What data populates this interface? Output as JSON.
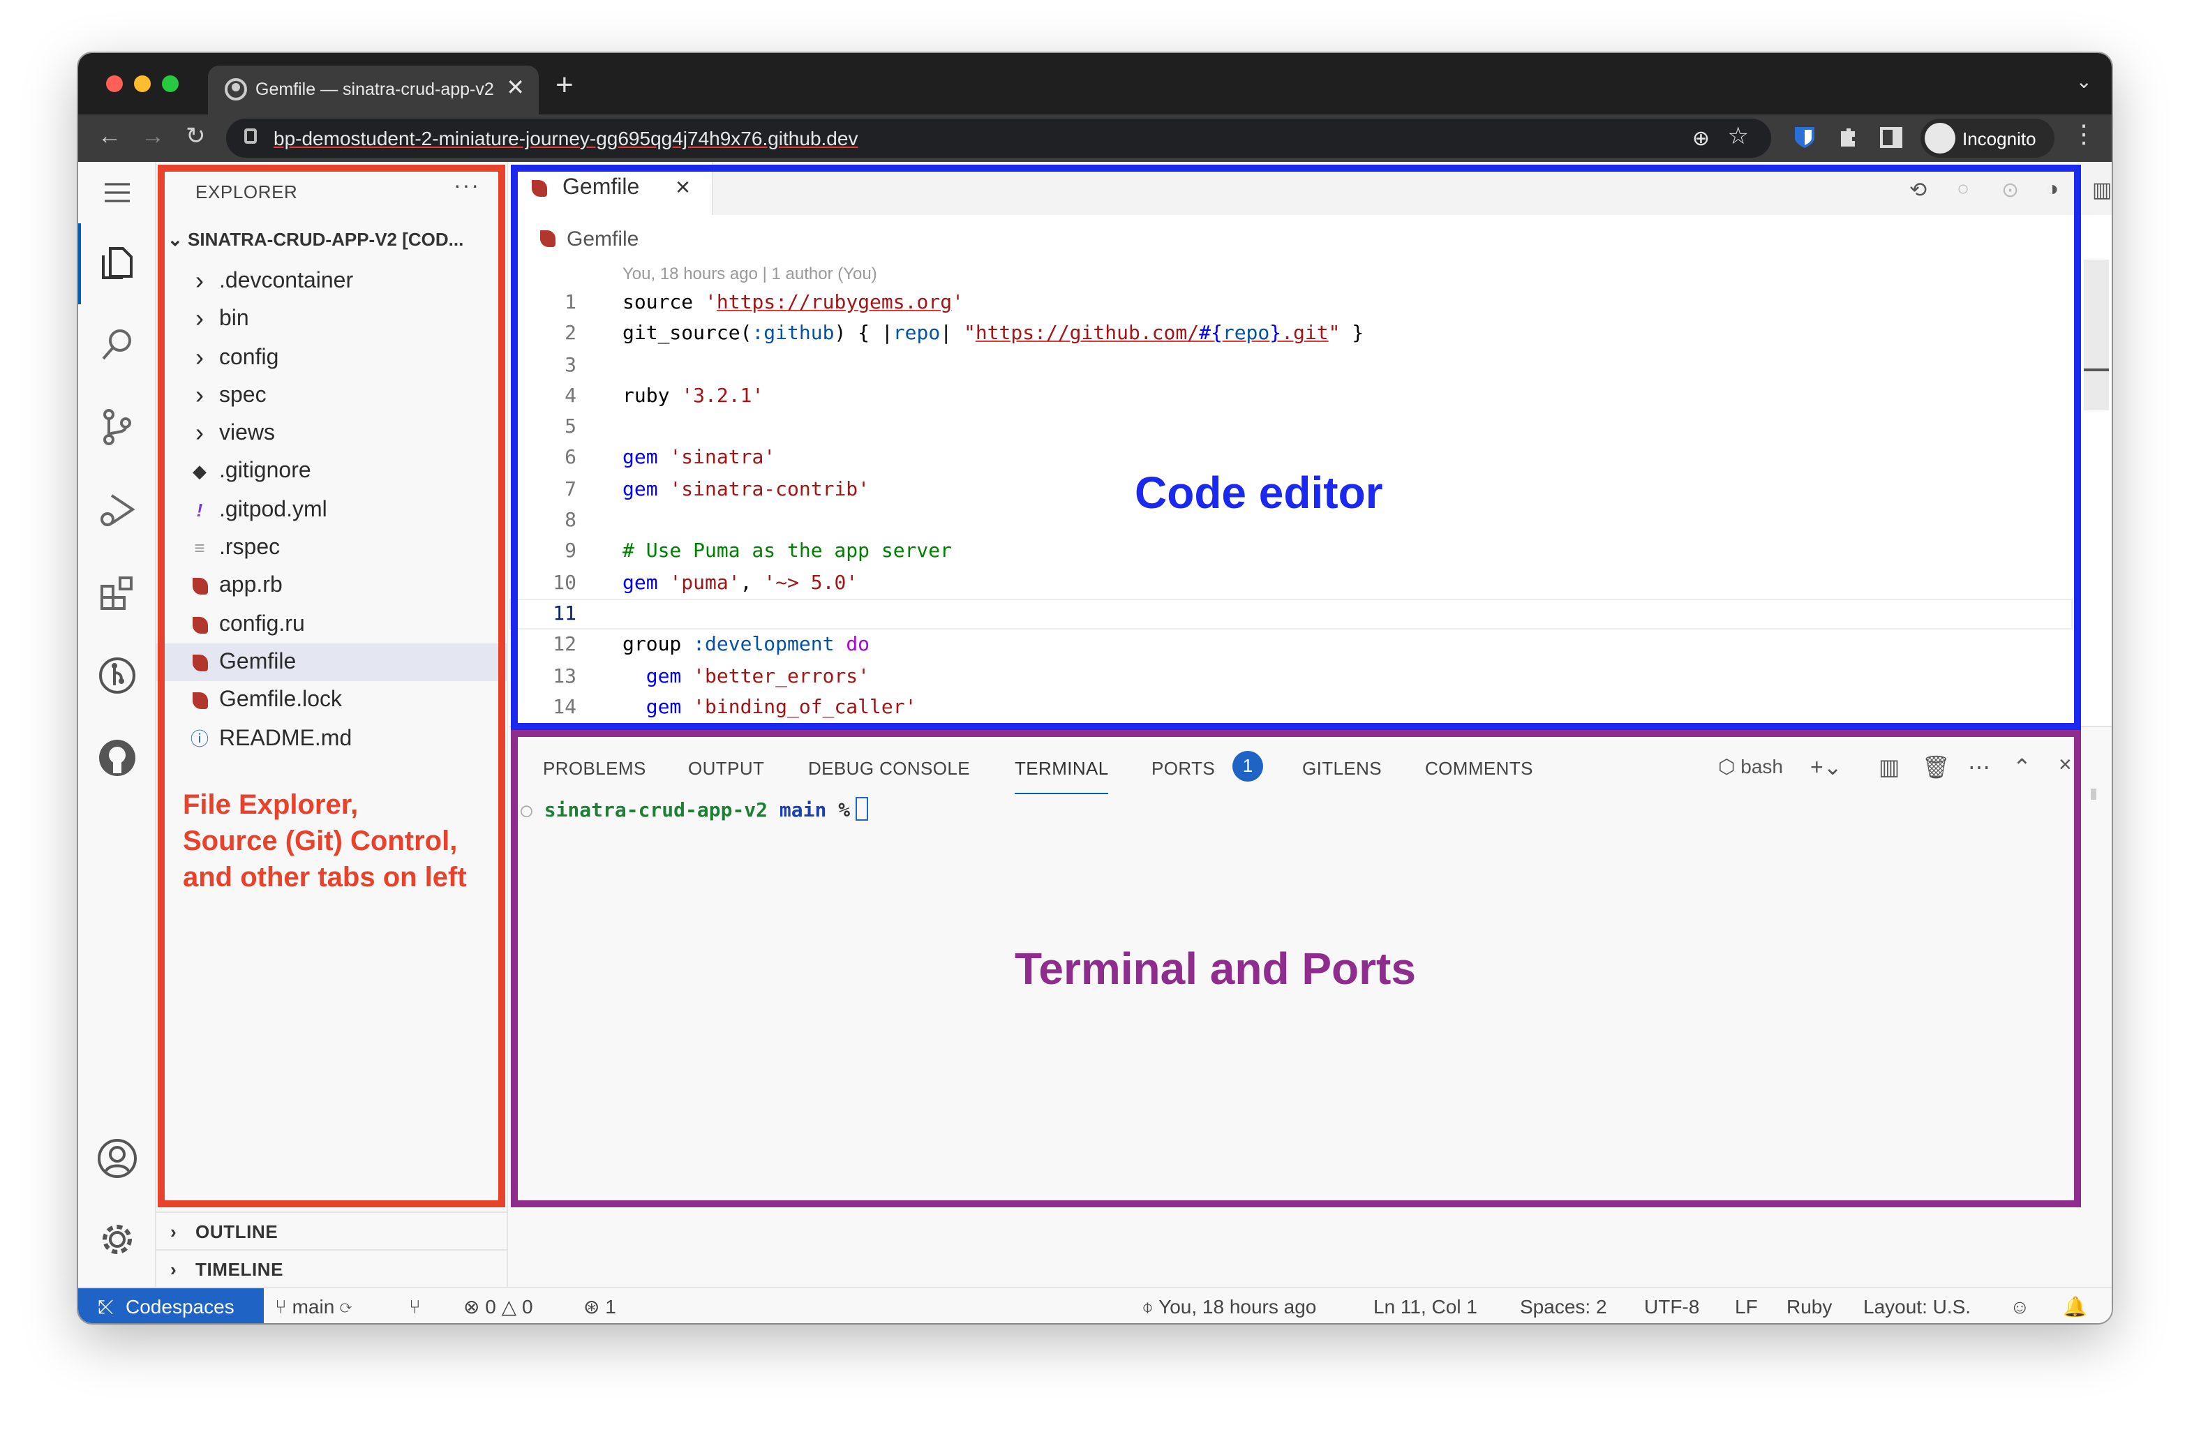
{
  "browser": {
    "tab_title": "Gemfile — sinatra-crud-app-v2",
    "close_glyph": "✕",
    "new_tab_glyph": "+",
    "url": "bp-demostudent-2-miniature-journey-gg695qg4j74h9x76.github.dev",
    "profile": "Incognito"
  },
  "sidebar": {
    "title": "EXPLORER",
    "more": "···",
    "root": "SINATRA-CRUD-APP-V2 [COD...",
    "items": [
      {
        "label": ".devcontainer",
        "icon": "chevron-right-icon",
        "glyph": "›"
      },
      {
        "label": "bin",
        "icon": "chevron-right-icon",
        "glyph": "›"
      },
      {
        "label": "config",
        "icon": "chevron-right-icon",
        "glyph": "›"
      },
      {
        "label": "spec",
        "icon": "chevron-right-icon",
        "glyph": "›"
      },
      {
        "label": "views",
        "icon": "chevron-right-icon",
        "glyph": "›"
      },
      {
        "label": ".gitignore",
        "icon": "git-icon",
        "glyph": "◆"
      },
      {
        "label": ".gitpod.yml",
        "icon": "yaml-icon",
        "glyph": "!"
      },
      {
        "label": ".rspec",
        "icon": "text-file-icon",
        "glyph": "≡"
      },
      {
        "label": "app.rb",
        "icon": "ruby-icon",
        "glyph": ""
      },
      {
        "label": "config.ru",
        "icon": "ruby-icon",
        "glyph": ""
      },
      {
        "label": "Gemfile",
        "icon": "ruby-icon",
        "glyph": "",
        "selected": true
      },
      {
        "label": "Gemfile.lock",
        "icon": "ruby-icon",
        "glyph": ""
      },
      {
        "label": "README.md",
        "icon": "info-icon",
        "glyph": "ⓘ"
      }
    ],
    "outline": "OUTLINE",
    "timeline": "TIMELINE"
  },
  "editor": {
    "tab": "Gemfile",
    "breadcrumb": "Gemfile",
    "blame": "You, 18 hours ago | 1 author (You)",
    "current_line": 11,
    "lines": [
      {
        "no": "1",
        "parts": [
          {
            "t": "source ",
            "c": ""
          },
          {
            "t": "'",
            "c": "str"
          },
          {
            "t": "https://rubygems.org",
            "c": "str url"
          },
          {
            "t": "'",
            "c": "str"
          }
        ]
      },
      {
        "no": "2",
        "parts": [
          {
            "t": "git_source(",
            "c": ""
          },
          {
            "t": ":github",
            "c": "sym"
          },
          {
            "t": ") { |",
            "c": ""
          },
          {
            "t": "repo",
            "c": "sym"
          },
          {
            "t": "| ",
            "c": ""
          },
          {
            "t": "\"",
            "c": "str"
          },
          {
            "t": "https://github.com/",
            "c": "str url"
          },
          {
            "t": "#{",
            "c": "kw url"
          },
          {
            "t": "repo",
            "c": "sym url"
          },
          {
            "t": "}",
            "c": "kw url"
          },
          {
            "t": ".git",
            "c": "str url"
          },
          {
            "t": "\"",
            "c": "str"
          },
          {
            "t": " }",
            "c": ""
          }
        ]
      },
      {
        "no": "3",
        "parts": []
      },
      {
        "no": "4",
        "parts": [
          {
            "t": "ruby ",
            "c": ""
          },
          {
            "t": "'3.2.1'",
            "c": "str"
          }
        ]
      },
      {
        "no": "5",
        "parts": []
      },
      {
        "no": "6",
        "parts": [
          {
            "t": "gem ",
            "c": "kw"
          },
          {
            "t": "'sinatra'",
            "c": "str"
          }
        ]
      },
      {
        "no": "7",
        "parts": [
          {
            "t": "gem ",
            "c": "kw"
          },
          {
            "t": "'sinatra-contrib'",
            "c": "str"
          }
        ]
      },
      {
        "no": "8",
        "parts": []
      },
      {
        "no": "9",
        "parts": [
          {
            "t": "# Use Puma as the app server",
            "c": "cm"
          }
        ]
      },
      {
        "no": "10",
        "parts": [
          {
            "t": "gem ",
            "c": "kw"
          },
          {
            "t": "'puma'",
            "c": "str"
          },
          {
            "t": ", ",
            "c": ""
          },
          {
            "t": "'~> 5.0'",
            "c": "str"
          }
        ]
      },
      {
        "no": "11",
        "parts": []
      },
      {
        "no": "12",
        "parts": [
          {
            "t": "group ",
            "c": ""
          },
          {
            "t": ":development ",
            "c": "sym"
          },
          {
            "t": "do",
            "c": "mag"
          }
        ]
      },
      {
        "no": "13",
        "parts": [
          {
            "t": "  ",
            "c": ""
          },
          {
            "t": "gem ",
            "c": "kw"
          },
          {
            "t": "'better_errors'",
            "c": "str"
          }
        ]
      },
      {
        "no": "14",
        "parts": [
          {
            "t": "  ",
            "c": ""
          },
          {
            "t": "gem ",
            "c": "kw"
          },
          {
            "t": "'binding_of_caller'",
            "c": "str"
          }
        ]
      }
    ]
  },
  "panel": {
    "tabs": [
      "PROBLEMS",
      "OUTPUT",
      "DEBUG CONSOLE",
      "TERMINAL",
      "PORTS",
      "GITLENS",
      "COMMENTS"
    ],
    "active_tab": "TERMINAL",
    "ports_badge": "1",
    "shell": "bash",
    "terminal": {
      "dir": "sinatra-crud-app-v2",
      "branch": "main",
      "prompt": "%"
    }
  },
  "statusbar": {
    "remote": "Codespaces",
    "branch": "main",
    "errors": "0",
    "warnings": "0",
    "ports": "1",
    "blame": "You, 18 hours ago",
    "cursor": "Ln 11, Col 1",
    "spaces": "Spaces: 2",
    "encoding": "UTF-8",
    "eol": "LF",
    "language": "Ruby",
    "layout": "Layout: U.S."
  },
  "annotations": {
    "explorer": "File Explorer,\nSource (Git) Control,\nand other tabs on left",
    "editor": "Code editor",
    "panel": "Terminal and Ports"
  },
  "colors": {
    "explorer": "#e8412c",
    "editor": "#1a28f0",
    "panel": "#8e2d8e",
    "accent": "#1f63c5"
  }
}
